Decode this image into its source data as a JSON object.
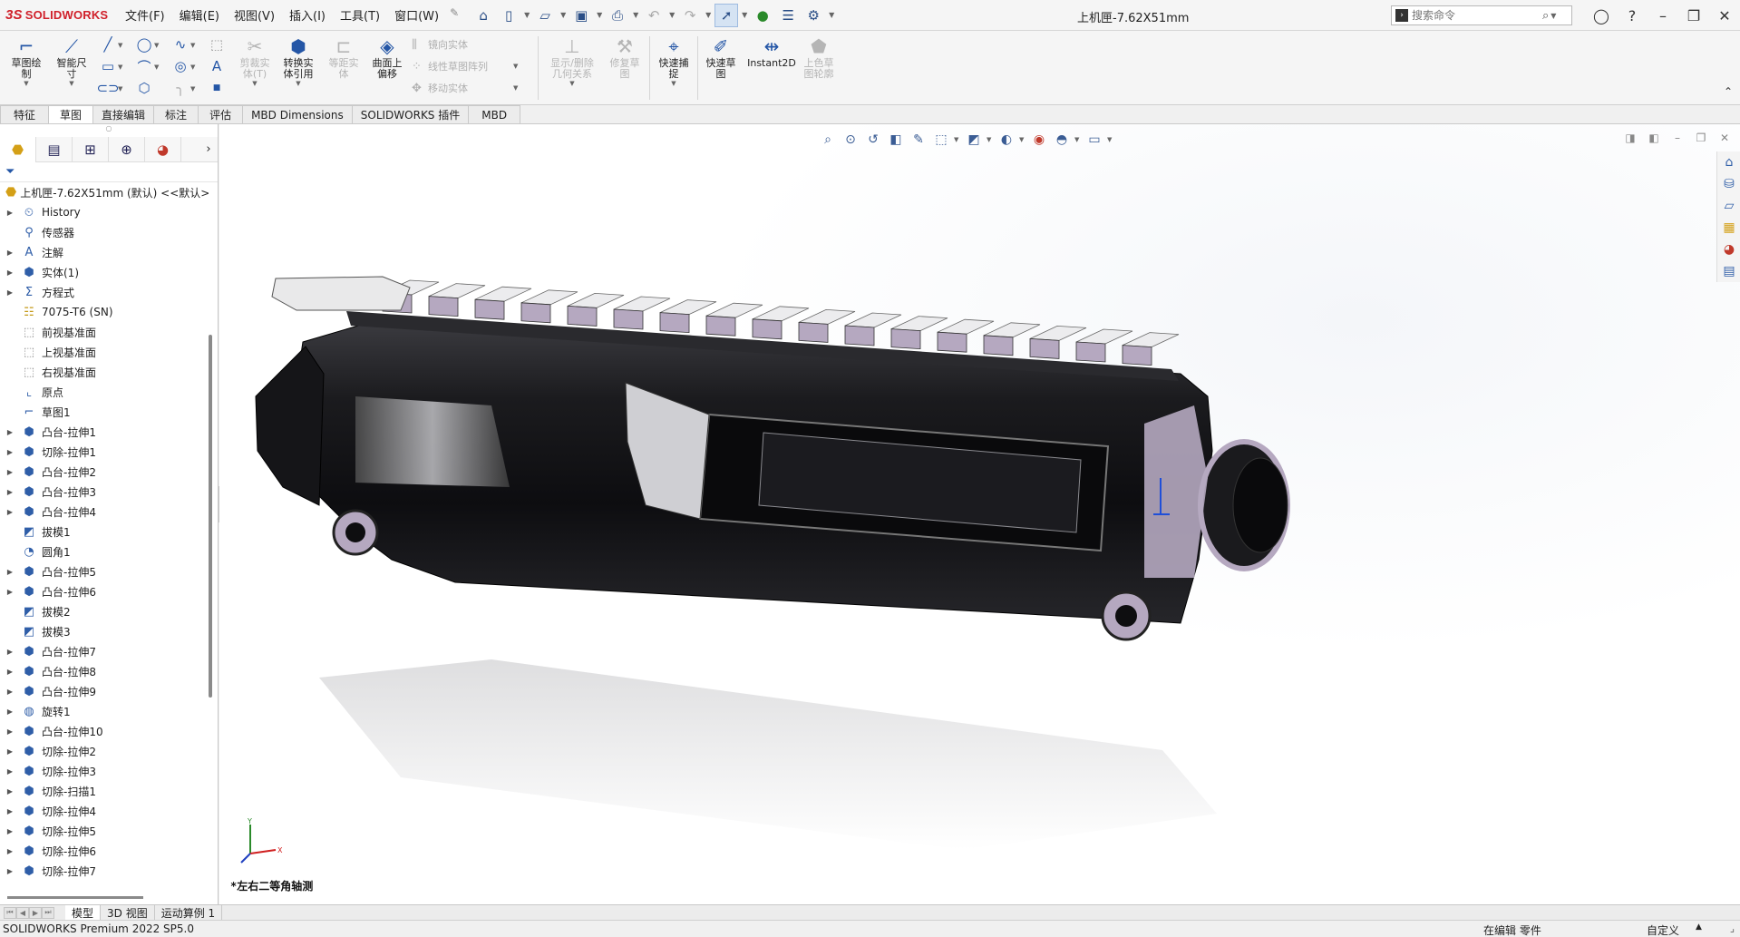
{
  "app": {
    "logo_prefix": "3S",
    "logo_text": "SOLIDWORKS",
    "document_title": "上机匣-7.62X51mm"
  },
  "menus": [
    "文件(F)",
    "编辑(E)",
    "视图(V)",
    "插入(I)",
    "工具(T)",
    "窗口(W)"
  ],
  "search": {
    "placeholder": "搜索命令"
  },
  "ribbon": {
    "sketch": "草图绘\n制",
    "smart_dimension": "智能尺\n寸",
    "trim": "剪裁实\n体(T)",
    "convert": "转换实\n体引用",
    "offset": "等距实\n体",
    "surface_offset": "曲面上\n偏移",
    "mirror": "镜向实体",
    "linear_pattern": "线性草图阵列",
    "move": "移动实体",
    "show_relations": "显示/删除\n几何关系",
    "repair": "修复草\n图",
    "quick_snap": "快速捕\n捉",
    "rapid_sketch": "快速草\n图",
    "instant2d": "Instant2D",
    "shaded_contours": "上色草\n图轮廓"
  },
  "tabs": [
    "特征",
    "草图",
    "直接编辑",
    "标注",
    "评估",
    "MBD Dimensions",
    "SOLIDWORKS 插件",
    "MBD"
  ],
  "active_tab": "草图",
  "feature_tree": {
    "root": "上机匣-7.62X51mm (默认) <<默认>",
    "nodes": [
      {
        "label": "History",
        "icon": "history",
        "expandable": true
      },
      {
        "label": "传感器",
        "icon": "sensor",
        "expandable": false
      },
      {
        "label": "注解",
        "icon": "annotation",
        "expandable": true
      },
      {
        "label": "实体(1)",
        "icon": "solid-bodies",
        "expandable": true
      },
      {
        "label": "方程式",
        "icon": "equations",
        "expandable": true
      },
      {
        "label": "7075-T6 (SN)",
        "icon": "material",
        "expandable": false
      },
      {
        "label": "前视基准面",
        "icon": "plane",
        "expandable": false
      },
      {
        "label": "上视基准面",
        "icon": "plane",
        "expandable": false
      },
      {
        "label": "右视基准面",
        "icon": "plane",
        "expandable": false
      },
      {
        "label": "原点",
        "icon": "origin",
        "expandable": false
      },
      {
        "label": "草图1",
        "icon": "sketch",
        "expandable": false
      },
      {
        "label": "凸台-拉伸1",
        "icon": "extrude",
        "expandable": true
      },
      {
        "label": "切除-拉伸1",
        "icon": "cut",
        "expandable": true
      },
      {
        "label": "凸台-拉伸2",
        "icon": "extrude",
        "expandable": true
      },
      {
        "label": "凸台-拉伸3",
        "icon": "extrude",
        "expandable": true
      },
      {
        "label": "凸台-拉伸4",
        "icon": "extrude",
        "expandable": true
      },
      {
        "label": "拔模1",
        "icon": "draft",
        "expandable": false
      },
      {
        "label": "圆角1",
        "icon": "fillet",
        "expandable": false
      },
      {
        "label": "凸台-拉伸5",
        "icon": "extrude",
        "expandable": true
      },
      {
        "label": "凸台-拉伸6",
        "icon": "extrude",
        "expandable": true
      },
      {
        "label": "拔模2",
        "icon": "draft",
        "expandable": false
      },
      {
        "label": "拔模3",
        "icon": "draft",
        "expandable": false
      },
      {
        "label": "凸台-拉伸7",
        "icon": "extrude",
        "expandable": true
      },
      {
        "label": "凸台-拉伸8",
        "icon": "extrude",
        "expandable": true
      },
      {
        "label": "凸台-拉伸9",
        "icon": "extrude",
        "expandable": true
      },
      {
        "label": "旋转1",
        "icon": "revolve",
        "expandable": true
      },
      {
        "label": "凸台-拉伸10",
        "icon": "extrude",
        "expandable": true
      },
      {
        "label": "切除-拉伸2",
        "icon": "cut",
        "expandable": true
      },
      {
        "label": "切除-拉伸3",
        "icon": "cut",
        "expandable": true
      },
      {
        "label": "切除-扫描1",
        "icon": "sweep-cut",
        "expandable": true
      },
      {
        "label": "切除-拉伸4",
        "icon": "cut",
        "expandable": true
      },
      {
        "label": "切除-拉伸5",
        "icon": "cut",
        "expandable": true
      },
      {
        "label": "切除-拉伸6",
        "icon": "cut",
        "expandable": true
      },
      {
        "label": "切除-拉伸7",
        "icon": "cut",
        "expandable": true
      }
    ]
  },
  "viewport": {
    "view_name": "*左右二等角轴测",
    "triad": {
      "x": "X",
      "y": "Y"
    }
  },
  "bottom_tabs": [
    "模型",
    "3D 视图",
    "运动算例 1"
  ],
  "active_bottom_tab": "模型",
  "status": {
    "product": "SOLIDWORKS Premium 2022 SP5.0",
    "edit_state": "在编辑 零件",
    "units": "自定义"
  },
  "colors": {
    "brand_red": "#d0202a",
    "accent_blue": "#2456a6",
    "part_black": "#1a1a1d",
    "part_lavender": "#b5a8c0"
  }
}
